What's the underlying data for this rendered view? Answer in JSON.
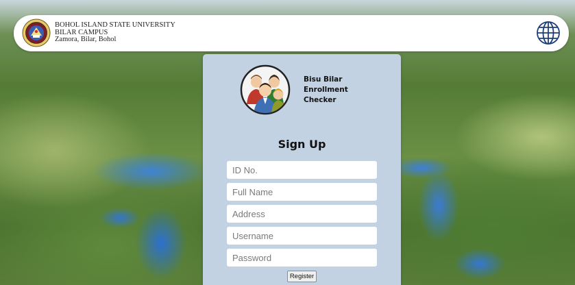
{
  "header": {
    "university_name": "BOHOL ISLAND STATE UNIVERSITY",
    "campus": "BILAR CAMPUS",
    "location": "Zamora, Bilar, Bohol",
    "seal_icon": "university-seal-icon",
    "language_icon": "globe-icon"
  },
  "app": {
    "title_line1": "Bisu Bilar",
    "title_line2": "Enrollment",
    "title_line3": "Checker",
    "logo_icon": "group-people-avatar-icon"
  },
  "form": {
    "heading": "Sign Up",
    "id_placeholder": "ID No.",
    "fullname_placeholder": "Full Name",
    "address_placeholder": "Address",
    "username_placeholder": "Username",
    "password_placeholder": "Password",
    "submit_label": "Register"
  },
  "colors": {
    "card_background": "#c3d2e2",
    "header_background": "#ffffff",
    "globe_color": "#1e3f7a"
  }
}
